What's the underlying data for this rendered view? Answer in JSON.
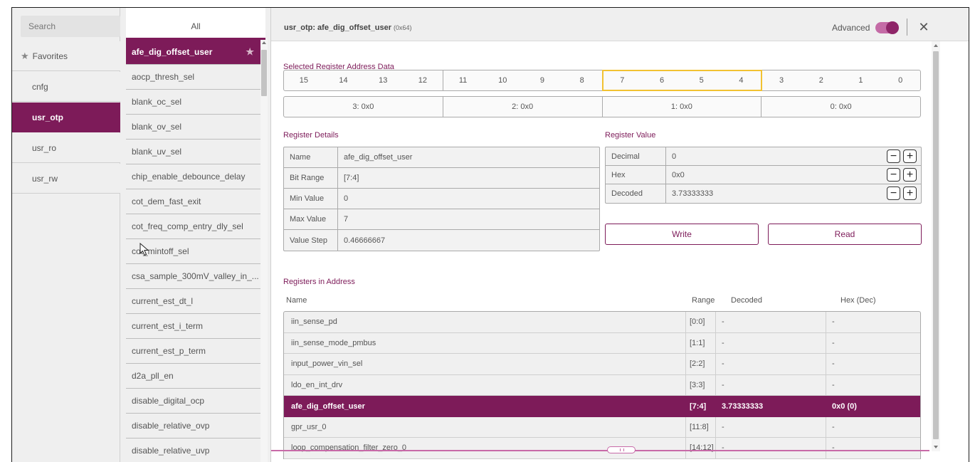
{
  "search": {
    "placeholder": "Search"
  },
  "tabs": {
    "all": "All"
  },
  "categories": [
    {
      "label": "Favorites",
      "icon": "star-icon",
      "selected": false
    },
    {
      "label": "cnfg",
      "selected": false
    },
    {
      "label": "usr_otp",
      "selected": true
    },
    {
      "label": "usr_ro",
      "selected": false
    },
    {
      "label": "usr_rw",
      "selected": false
    }
  ],
  "registers": [
    {
      "label": "afe_dig_offset_user",
      "selected": true
    },
    {
      "label": "aocp_thresh_sel"
    },
    {
      "label": "blank_oc_sel"
    },
    {
      "label": "blank_ov_sel"
    },
    {
      "label": "blank_uv_sel"
    },
    {
      "label": "chip_enable_debounce_delay"
    },
    {
      "label": "cot_dem_fast_exit"
    },
    {
      "label": "cot_freq_comp_entry_dly_sel"
    },
    {
      "label": "cot_mintoff_sel"
    },
    {
      "label": "csa_sample_300mV_valley_in_..."
    },
    {
      "label": "current_est_dt_l"
    },
    {
      "label": "current_est_i_term"
    },
    {
      "label": "current_est_p_term"
    },
    {
      "label": "d2a_pll_en"
    },
    {
      "label": "disable_digital_ocp"
    },
    {
      "label": "disable_relative_ovp"
    },
    {
      "label": "disable_relative_uvp"
    }
  ],
  "header": {
    "title": "usr_otp: afe_dig_offset_user",
    "address": "(0x64)",
    "advanced_label": "Advanced",
    "advanced_on": true,
    "close_icon": "close-icon"
  },
  "selected_address": {
    "title": "Selected Register Address Data",
    "bits": [
      [
        "15",
        "14",
        "13",
        "12"
      ],
      [
        "11",
        "10",
        "9",
        "8"
      ],
      [
        "7",
        "6",
        "5",
        "4"
      ],
      [
        "3",
        "2",
        "1",
        "0"
      ]
    ],
    "highlighted_nibble": 2,
    "fields": [
      "3: 0x0",
      "2: 0x0",
      "1: 0x0",
      "0: 0x0"
    ]
  },
  "details": {
    "title": "Register Details",
    "rows": [
      {
        "key": "Name",
        "value": "afe_dig_offset_user"
      },
      {
        "key": "Bit Range",
        "value": "[7:4]"
      },
      {
        "key": "Min Value",
        "value": "0"
      },
      {
        "key": "Max Value",
        "value": "7"
      },
      {
        "key": "Value Step",
        "value": "0.46666667"
      }
    ]
  },
  "value": {
    "title": "Register Value",
    "rows": [
      {
        "key": "Decimal",
        "value": "0"
      },
      {
        "key": "Hex",
        "value": "0x0"
      },
      {
        "key": "Decoded",
        "value": "3.73333333"
      }
    ],
    "minus": "−",
    "plus": "+",
    "write_label": "Write",
    "read_label": "Read"
  },
  "in_address": {
    "title": "Registers in Address",
    "columns": {
      "name": "Name",
      "range": "Range",
      "decoded": "Decoded",
      "hex": "Hex (Dec)"
    },
    "rows": [
      {
        "name": "iin_sense_pd",
        "range": "[0:0]",
        "decoded": "-",
        "hex": "-"
      },
      {
        "name": "iin_sense_mode_pmbus",
        "range": "[1:1]",
        "decoded": "-",
        "hex": "-"
      },
      {
        "name": "input_power_vin_sel",
        "range": "[2:2]",
        "decoded": "-",
        "hex": "-"
      },
      {
        "name": "ldo_en_int_drv",
        "range": "[3:3]",
        "decoded": "-",
        "hex": "-"
      },
      {
        "name": "afe_dig_offset_user",
        "range": "[7:4]",
        "decoded": "3.73333333",
        "hex": "0x0 (0)",
        "selected": true
      },
      {
        "name": "gpr_usr_0",
        "range": "[11:8]",
        "decoded": "-",
        "hex": "-"
      },
      {
        "name": "loop_compensation_filter_zero_0",
        "range": "[14:12]",
        "decoded": "-",
        "hex": "-"
      }
    ]
  },
  "colors": {
    "accent": "#7d1b59",
    "highlight": "#f2c232",
    "toggle_track": "#c46ba6"
  }
}
